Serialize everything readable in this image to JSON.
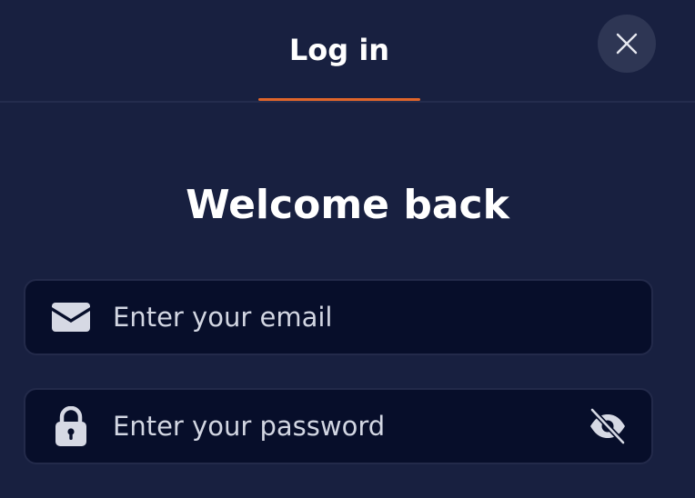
{
  "header": {
    "tab_label": "Log in",
    "active_tab_color": "#e0652a"
  },
  "main": {
    "heading": "Welcome back"
  },
  "form": {
    "email": {
      "icon": "envelope-icon",
      "placeholder": "Enter your email",
      "value": ""
    },
    "password": {
      "icon": "lock-icon",
      "placeholder": "Enter your password",
      "value": "",
      "toggle_icon": "eye-slash-icon"
    }
  },
  "icons": {
    "close": "close-icon"
  }
}
